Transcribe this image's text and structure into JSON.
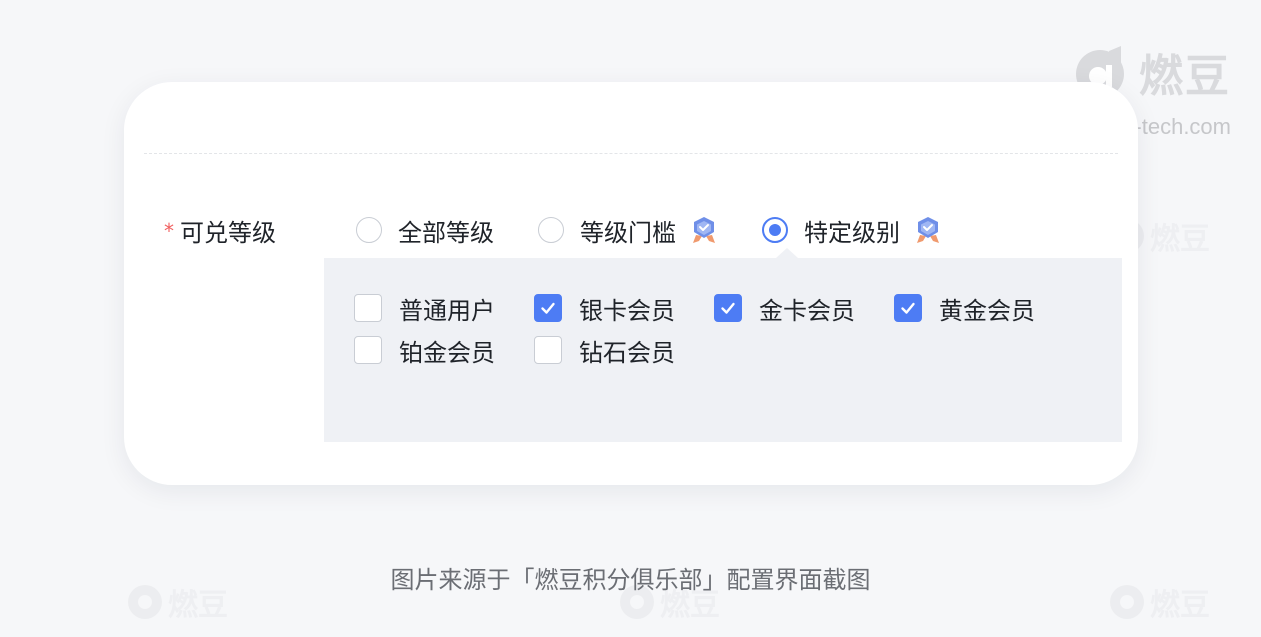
{
  "brand": {
    "name": "燃豆",
    "url": "randou-tech.com",
    "logo_icon": "randou-logo-icon"
  },
  "form": {
    "field": {
      "required_mark": "*",
      "label": "可兑等级"
    },
    "radio_options": [
      {
        "label": "全部等级",
        "checked": false,
        "badge": false
      },
      {
        "label": "等级门槛",
        "checked": false,
        "badge": true
      },
      {
        "label": "特定级别",
        "checked": true,
        "badge": true
      }
    ],
    "badge_icon": "vip-badge-icon",
    "levels": [
      {
        "label": "普通用户",
        "checked": false
      },
      {
        "label": "银卡会员",
        "checked": true
      },
      {
        "label": "金卡会员",
        "checked": true
      },
      {
        "label": "黄金会员",
        "checked": true
      },
      {
        "label": "铂金会员",
        "checked": false
      },
      {
        "label": "钻石会员",
        "checked": false
      }
    ]
  },
  "caption": "图片来源于「燃豆积分俱乐部」配置界面截图",
  "colors": {
    "accent": "#4d7cf4",
    "required": "#f05f5f",
    "panel_bg": "#eff1f5",
    "page_bg": "#f6f7f9"
  }
}
